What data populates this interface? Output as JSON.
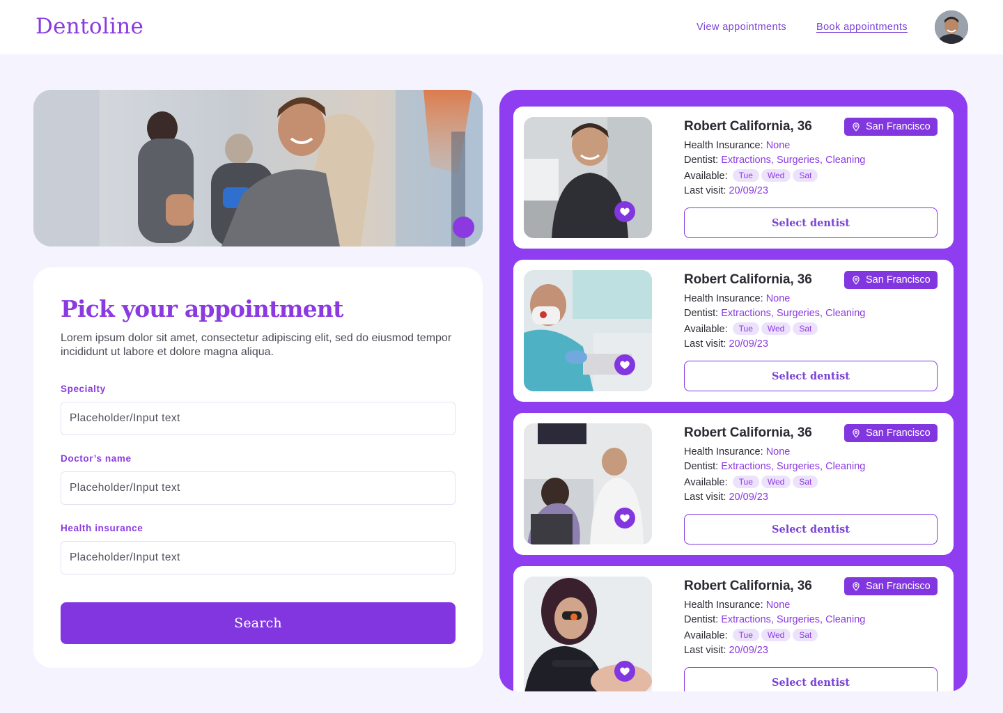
{
  "header": {
    "logo": "Dentoline",
    "nav": {
      "view_label": "View appointments",
      "book_label": "Book appointments"
    }
  },
  "form": {
    "title": "Pick your appointment",
    "description": "Lorem ipsum dolor sit amet, consectetur adipiscing elit, sed do eiusmod tempor incididunt ut labore et dolore magna aliqua.",
    "fields": [
      {
        "label": "Specialty",
        "placeholder": "Placeholder/Input text"
      },
      {
        "label": "Doctor’s name",
        "placeholder": "Placeholder/Input text"
      },
      {
        "label": "Health insurance",
        "placeholder": "Placeholder/Input text"
      }
    ],
    "search_label": "Search"
  },
  "dentists": [
    {
      "name": "Robert California, 36",
      "location": "San Francisco",
      "insurance_label": "Health Insurance:",
      "insurance": "None",
      "specialty_label": "Dentist:",
      "specialties": "Extractions, Surgeries, Cleaning",
      "available_label": "Available:",
      "days": [
        "Tue",
        "Wed",
        "Sat"
      ],
      "last_visit_label": "Last visit:",
      "last_visit": "20/09/23",
      "select_label": "Select dentist"
    },
    {
      "name": "Robert California, 36",
      "location": "San Francisco",
      "insurance_label": "Health Insurance:",
      "insurance": "None",
      "specialty_label": "Dentist:",
      "specialties": "Extractions, Surgeries, Cleaning",
      "available_label": "Available:",
      "days": [
        "Tue",
        "Wed",
        "Sat"
      ],
      "last_visit_label": "Last visit:",
      "last_visit": "20/09/23",
      "select_label": "Select dentist"
    },
    {
      "name": "Robert California, 36",
      "location": "San Francisco",
      "insurance_label": "Health Insurance:",
      "insurance": "None",
      "specialty_label": "Dentist:",
      "specialties": "Extractions, Surgeries, Cleaning",
      "available_label": "Available:",
      "days": [
        "Tue",
        "Wed",
        "Sat"
      ],
      "last_visit_label": "Last visit:",
      "last_visit": "20/09/23",
      "select_label": "Select dentist"
    },
    {
      "name": "Robert California, 36",
      "location": "San Francisco",
      "insurance_label": "Health Insurance:",
      "insurance": "None",
      "specialty_label": "Dentist:",
      "specialties": "Extractions, Surgeries, Cleaning",
      "available_label": "Available:",
      "days": [
        "Tue",
        "Wed",
        "Sat"
      ],
      "last_visit_label": "Last visit:",
      "last_visit": "20/09/23",
      "select_label": "Select dentist"
    }
  ],
  "icons": {
    "location": "map-pin-icon",
    "favorite": "heart-icon"
  },
  "colors": {
    "brand": "#8236e0",
    "panel": "#8e3df0",
    "page_bg": "#f5f3fe",
    "chip_bg": "#ede2fc"
  }
}
